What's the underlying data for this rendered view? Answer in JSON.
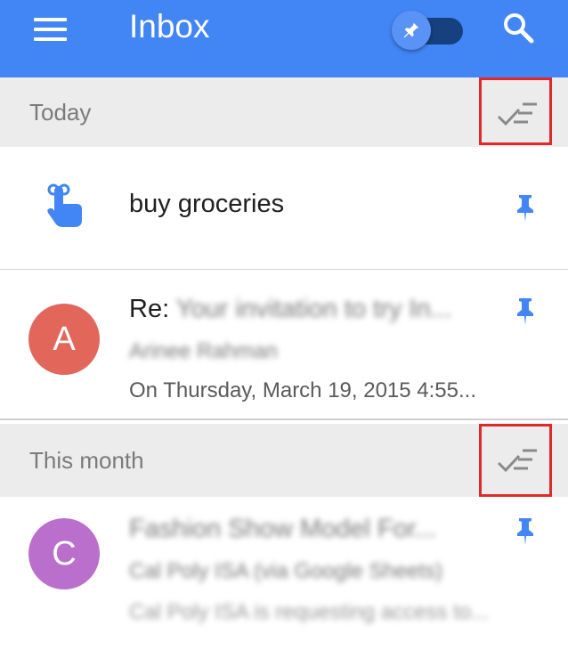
{
  "app": {
    "title": "Inbox",
    "accent_color": "#4285f4",
    "toggle_state": "pinned-only off"
  },
  "icons": {
    "menu": "menu-icon",
    "pin_toggle": "pin-icon",
    "search": "search-icon",
    "sweep": "sweep-done-icon",
    "reminder": "reminder-finger-icon",
    "pinned": "pin-icon"
  },
  "sections": [
    {
      "label": "Today"
    },
    {
      "label": "This month"
    }
  ],
  "items": [
    {
      "subject": "buy groceries",
      "pinned": true
    },
    {
      "avatar_letter": "A",
      "avatar_color": "#e2675a",
      "subject_prefix": "Re: ",
      "subject_blurred": "Your invitation to try In...",
      "sender": "Arinee Rahman",
      "snippet": "On Thursday, March 19, 2015 4:55...",
      "pinned": true
    },
    {
      "avatar_letter": "C",
      "avatar_color": "#bb6fcc",
      "subject": "Fashion Show Model For...",
      "sender": "Cal Poly ISA (via Google Sheets)",
      "snippet": "Cal Poly ISA is requesting access to...",
      "pinned": true
    }
  ],
  "annotations": {
    "highlight_color": "#e02a2a"
  }
}
